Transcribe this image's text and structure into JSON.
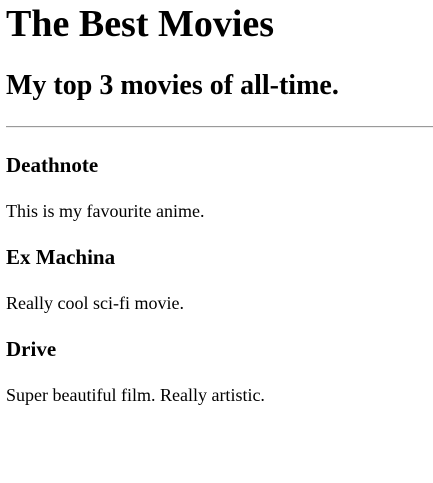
{
  "page": {
    "title": "The Best Movies",
    "subtitle": "My top 3 movies of all-time."
  },
  "movies": [
    {
      "title": "Deathnote",
      "description": "This is my favourite anime."
    },
    {
      "title": "Ex Machina",
      "description": "Really cool sci-fi movie."
    },
    {
      "title": "Drive",
      "description": "Super beautiful film. Really artistic."
    }
  ]
}
